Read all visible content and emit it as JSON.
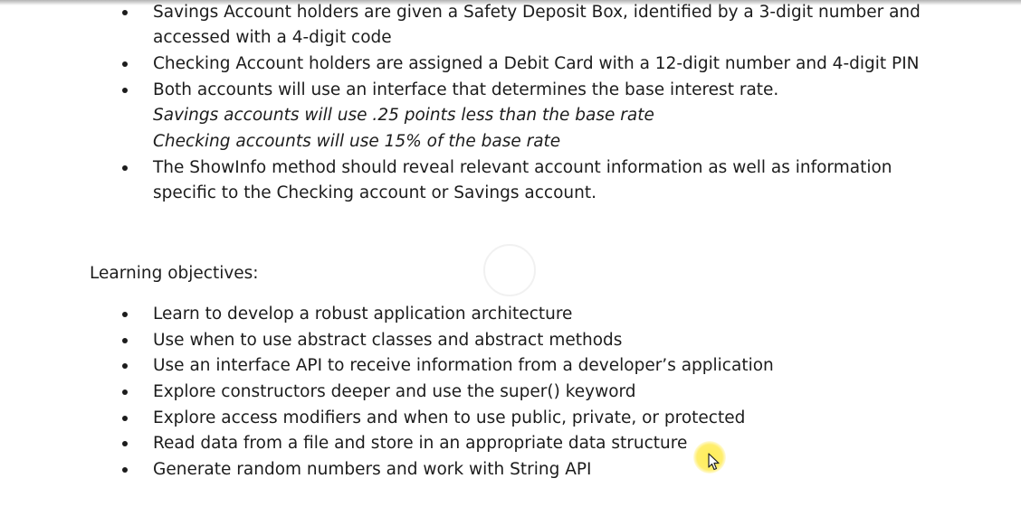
{
  "doc": {
    "top_bullets": [
      {
        "lines": [
          "Savings Account holders are given a Safety Deposit Box, identified by a 3-digit number and",
          "accessed with a 4-digit code"
        ]
      },
      {
        "lines": [
          "Checking Account holders are assigned a Debit Card with a 12-digit number and 4-digit PIN"
        ]
      },
      {
        "lines": [
          "Both accounts will use an interface that determines the base interest rate."
        ],
        "notes": [
          "Savings accounts will use .25 points less than the base rate",
          "Checking accounts will use 15% of the base rate"
        ]
      },
      {
        "lines": [
          "The ShowInfo method should reveal relevant account information as well as information",
          "specific to the Checking account or Savings account."
        ]
      }
    ],
    "objectives_heading": "Learning objectives:",
    "objectives": [
      "Learn to develop a robust application architecture",
      "Use when to use abstract classes and abstract methods",
      "Use an interface API to receive information from a developer’s application",
      "Explore constructors deeper and use the super() keyword",
      "Explore access modifiers and when to use public, private, or protected",
      "Read data from a file and store in an appropriate data structure",
      "Generate random numbers and work with String API"
    ]
  },
  "cursor": {
    "icon": "mouse-pointer-icon",
    "highlight_color": "#ffe84a"
  }
}
